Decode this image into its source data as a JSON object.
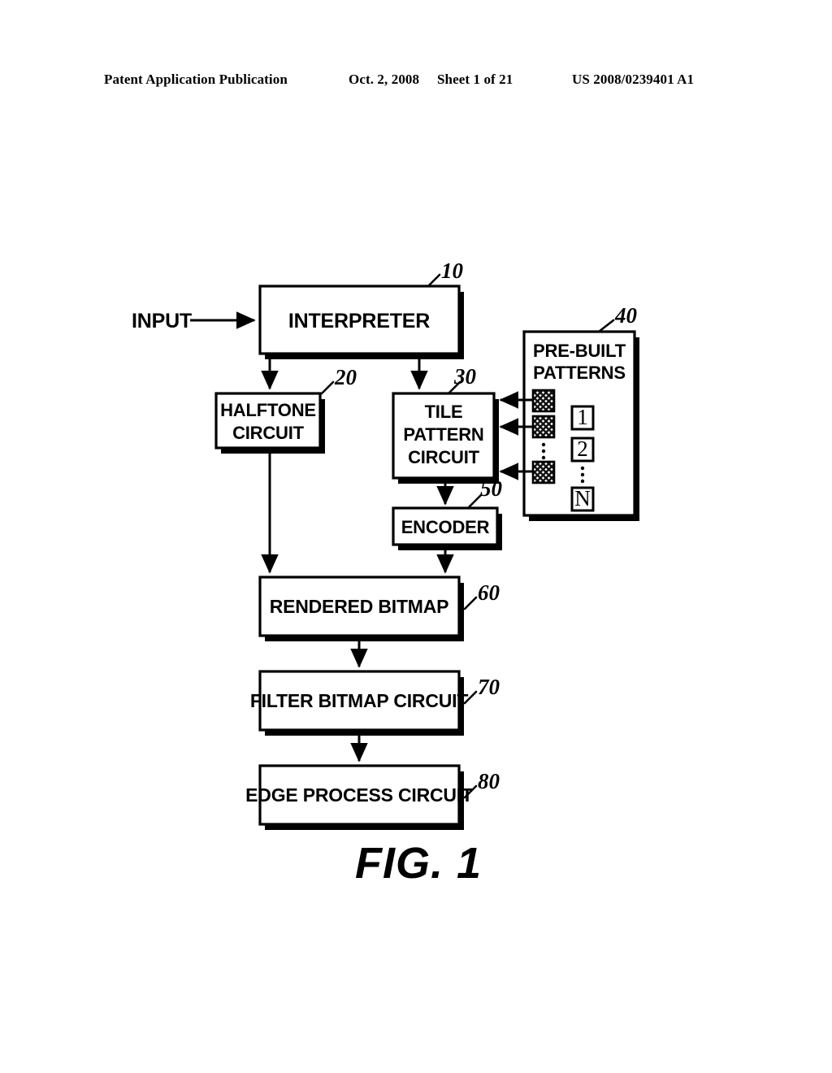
{
  "header": {
    "publication": "Patent Application Publication",
    "date": "Oct. 2, 2008",
    "sheet": "Sheet 1 of 21",
    "doc_number": "US 2008/0239401 A1"
  },
  "figure": {
    "caption": "FIG. 1",
    "input_label": "INPUT",
    "blocks": [
      {
        "id": "interpreter",
        "label": "INTERPRETER",
        "ref": "10"
      },
      {
        "id": "halftone",
        "label": "HALFTONE\nCIRCUIT",
        "ref": "20"
      },
      {
        "id": "tile_pattern",
        "label": "TILE\nPATTERN\nCIRCUIT",
        "ref": "30"
      },
      {
        "id": "prebuilt",
        "label": "PRE-BUILT\nPATTERNS",
        "ref": "40"
      },
      {
        "id": "encoder",
        "label": "ENCODER",
        "ref": "50"
      },
      {
        "id": "rendered",
        "label": "RENDERED BITMAP",
        "ref": "60"
      },
      {
        "id": "filter",
        "label": "FILTER BITMAP CIRCUIT",
        "ref": "70"
      },
      {
        "id": "edge",
        "label": "EDGE PROCESS CIRCUIT",
        "ref": "80"
      }
    ],
    "block_lines": {
      "interpreter": [
        "INTERPRETER"
      ],
      "halftone": [
        "HALFTONE",
        "CIRCUIT"
      ],
      "tile_pattern": [
        "TILE",
        "PATTERN",
        "CIRCUIT"
      ],
      "prebuilt": [
        "PRE-BUILT",
        "PATTERNS"
      ],
      "encoder": [
        "ENCODER"
      ],
      "rendered": [
        "RENDERED BITMAP"
      ],
      "filter": [
        "FILTER BITMAP CIRCUIT"
      ],
      "edge": [
        "EDGE PROCESS CIRCUIT"
      ]
    },
    "pattern_index_labels": [
      "1",
      "2",
      "N"
    ],
    "pattern_swatch_count": 3,
    "ellipsis_glyph": "⋮",
    "colors": {
      "ink": "#000000",
      "page": "#ffffff",
      "swatch_fill": "#d0d0d0"
    }
  }
}
